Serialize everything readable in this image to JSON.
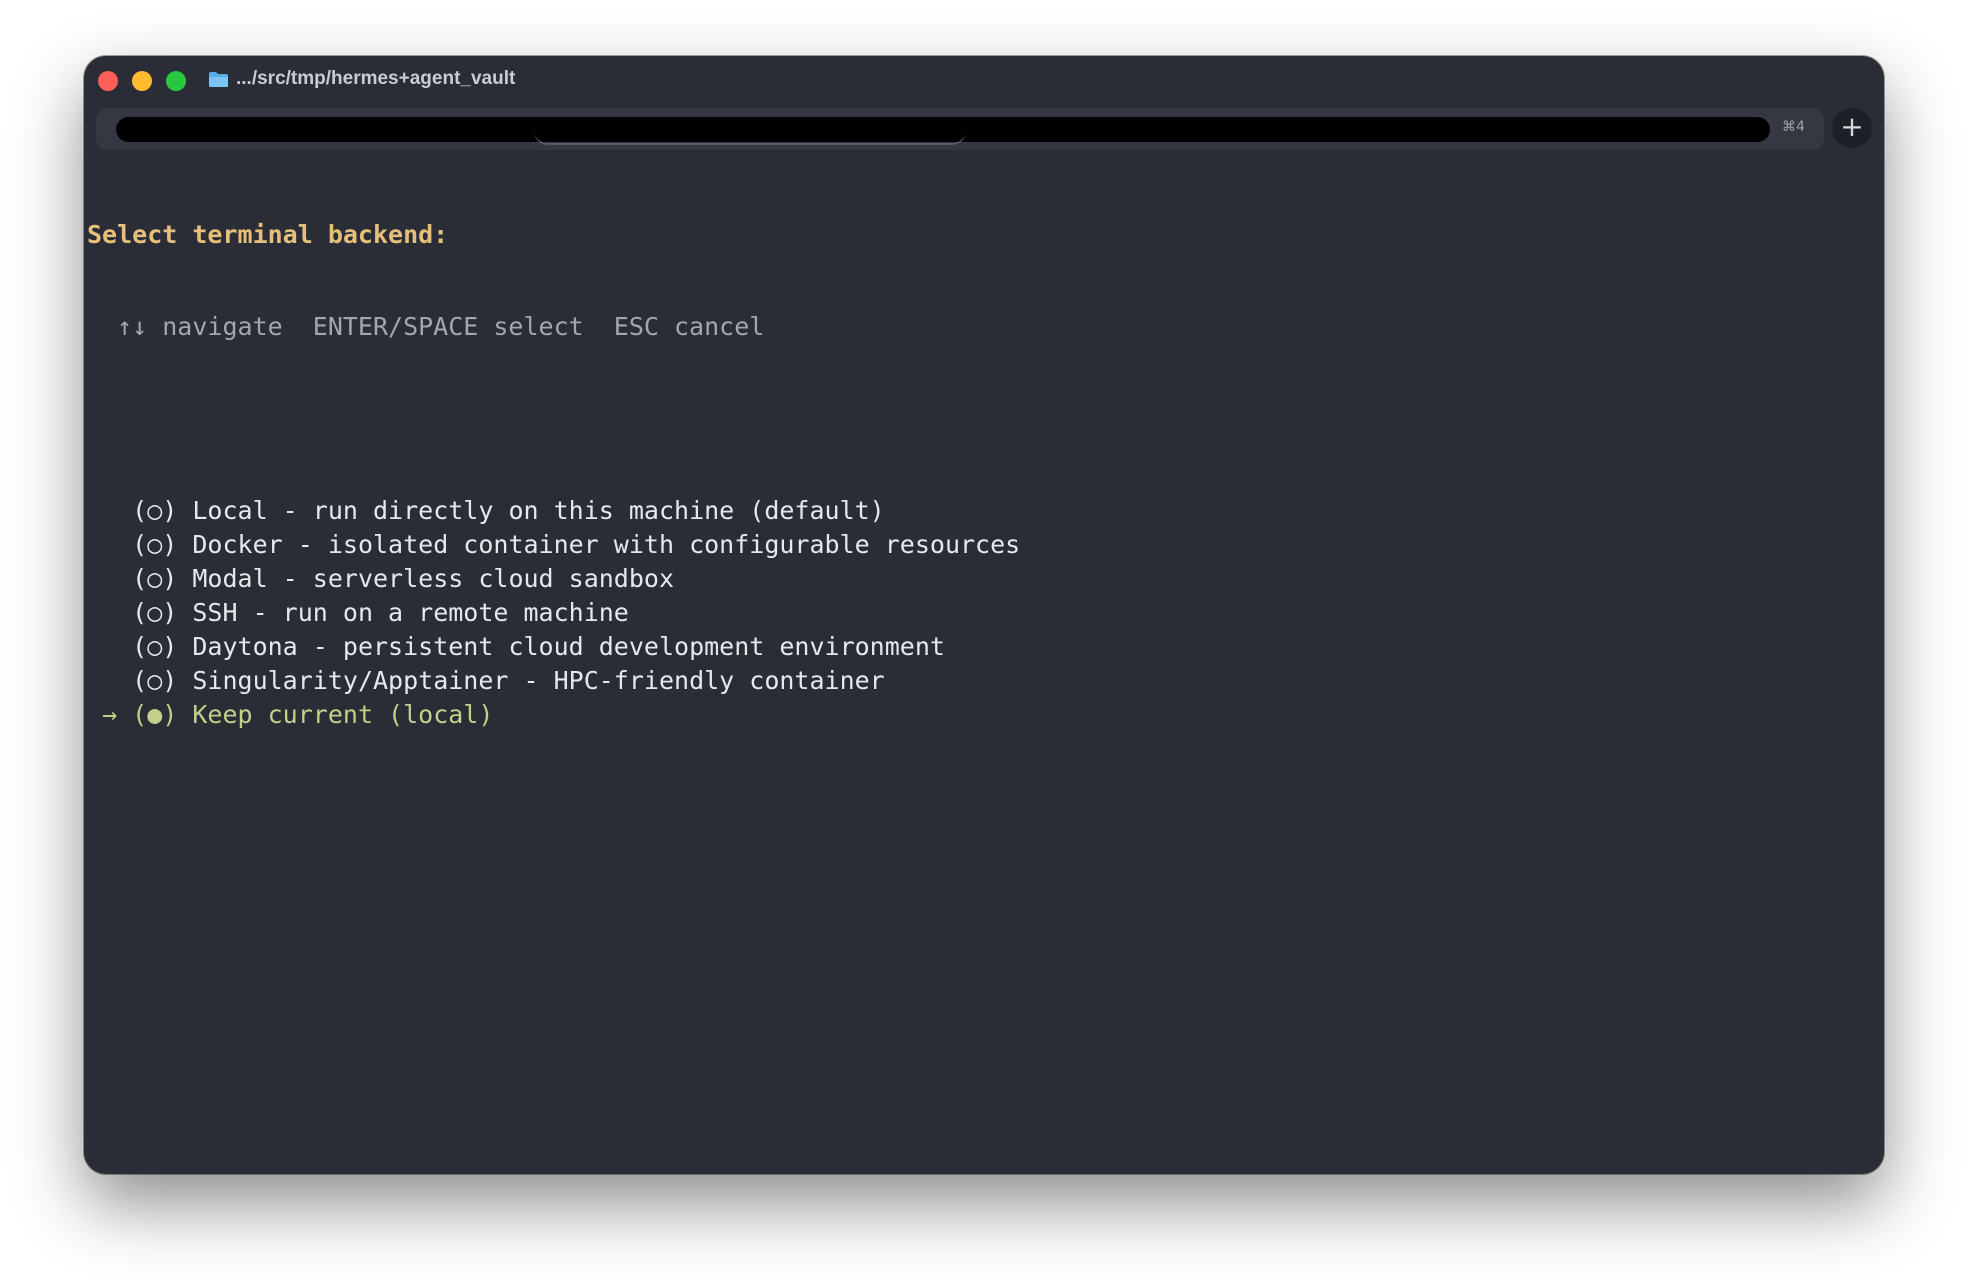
{
  "window": {
    "title": ".../src/tmp/hermes+agent_vault",
    "tab_shortcut": "⌘4",
    "new_tab_label": "+"
  },
  "terminal": {
    "prompt": "Select terminal backend:",
    "hint": "  ↑↓ navigate  ENTER/SPACE select  ESC cancel",
    "options": [
      {
        "marker": "   ",
        "radio": "(○)",
        "label": "Local - run directly on this machine (default)"
      },
      {
        "marker": "   ",
        "radio": "(○)",
        "label": "Docker - isolated container with configurable resources"
      },
      {
        "marker": "   ",
        "radio": "(○)",
        "label": "Modal - serverless cloud sandbox"
      },
      {
        "marker": "   ",
        "radio": "(○)",
        "label": "SSH - run on a remote machine"
      },
      {
        "marker": "   ",
        "radio": "(○)",
        "label": "Daytona - persistent cloud development environment"
      },
      {
        "marker": "   ",
        "radio": "(○)",
        "label": "Singularity/Apptainer - HPC-friendly container"
      },
      {
        "marker": " → ",
        "radio": "(●)",
        "label": "Keep current (local)"
      }
    ]
  },
  "colors": {
    "background": "#2a2d36",
    "prompt": "#e6c07b",
    "hint": "#a2a6ae",
    "selected": "#c3d08a",
    "text": "#e6e8ed"
  },
  "selected_index": 6
}
